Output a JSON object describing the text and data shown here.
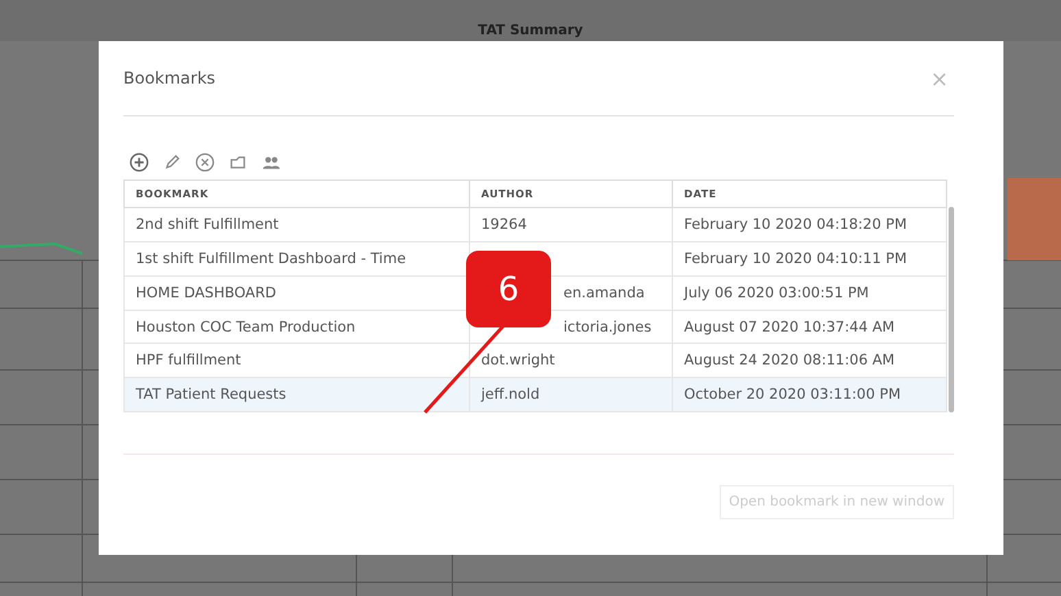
{
  "background": {
    "title": "TAT Summary"
  },
  "dialog": {
    "title": "Bookmarks",
    "close": "×",
    "toolbar": [
      {
        "kind": "add"
      },
      {
        "kind": "edit"
      },
      {
        "kind": "delete"
      },
      {
        "kind": "share"
      },
      {
        "kind": "users"
      }
    ],
    "table": {
      "columns": [
        "BOOKMARK",
        "AUTHOR",
        "DATE"
      ],
      "rows": [
        {
          "bookmark": "2nd shift Fulfillment",
          "author": "19264",
          "date": "February 10 2020 04:18:20 PM",
          "selected": false
        },
        {
          "bookmark": "1st shift Fulfillment Dashboard - Time",
          "date": "February 10 2020 04:10:11 PM",
          "selected": false
        },
        {
          "bookmark": "HOME DASHBOARD",
          "author": "en.amanda",
          "author_covered": true,
          "date": "July 06 2020 03:00:51 PM",
          "selected": false
        },
        {
          "bookmark": "Houston COC Team Production",
          "author": "ictoria.jones",
          "author_covered": true,
          "date": "August 07 2020 10:37:44 AM",
          "selected": false
        },
        {
          "bookmark": "HPF fulfillment",
          "author": "dot.wright",
          "date": "August 24 2020 08:11:06 AM",
          "selected": false
        },
        {
          "bookmark": "TAT Patient Requests",
          "author": "jeff.nold",
          "date": "October 20 2020 03:11:00 PM",
          "selected": true
        }
      ]
    },
    "button": {
      "label": "Open bookmark in new window",
      "disabled": true
    }
  },
  "callout": {
    "label": "6"
  }
}
